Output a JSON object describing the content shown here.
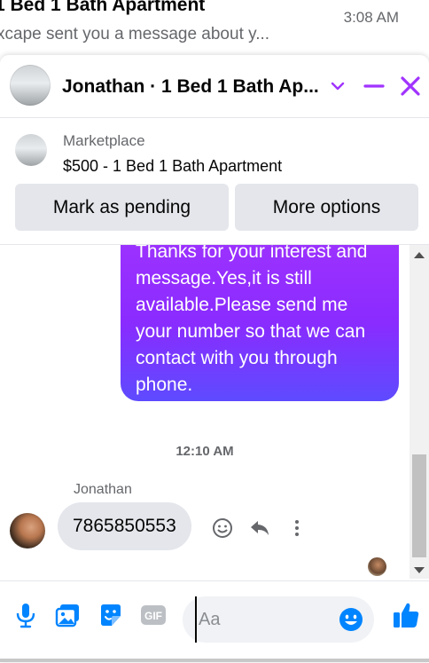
{
  "background_notification": {
    "title": "1 Bed 1 Bath Apartment",
    "subtitle": "xcape sent you a message about y...",
    "time": "3:08 AM"
  },
  "header": {
    "title": "Jonathan · 1 Bed 1 Bath Ap..."
  },
  "marketplace": {
    "label": "Marketplace",
    "listing": "$500 - 1 Bed 1 Bath Apartment",
    "mark_pending_label": "Mark as pending",
    "more_options_label": "More options"
  },
  "messages": {
    "outgoing_text": "Thanks for your interest and message.Yes,it is still available.Please send me your number so that we can contact with you through phone.",
    "timestamp": "12:10 AM",
    "sender_name": "Jonathan",
    "incoming_text": "7865850553"
  },
  "composer": {
    "placeholder": "Aa"
  },
  "colors": {
    "accent": "#0084ff",
    "header_icon": "#a033ff",
    "bubble_gradient_top": "#a033ff",
    "bubble_gradient_bottom": "#5e4bff",
    "incoming_bubble": "#e4e6eb"
  },
  "icons": {
    "header": [
      "chevron-down-icon",
      "minimize-icon",
      "close-icon"
    ],
    "message_actions": [
      "emoji-react-icon",
      "reply-icon",
      "more-icon"
    ],
    "composer": [
      "microphone-icon",
      "photo-icon",
      "sticker-icon",
      "gif-icon",
      "emoji-icon",
      "thumbs-up-icon"
    ]
  }
}
